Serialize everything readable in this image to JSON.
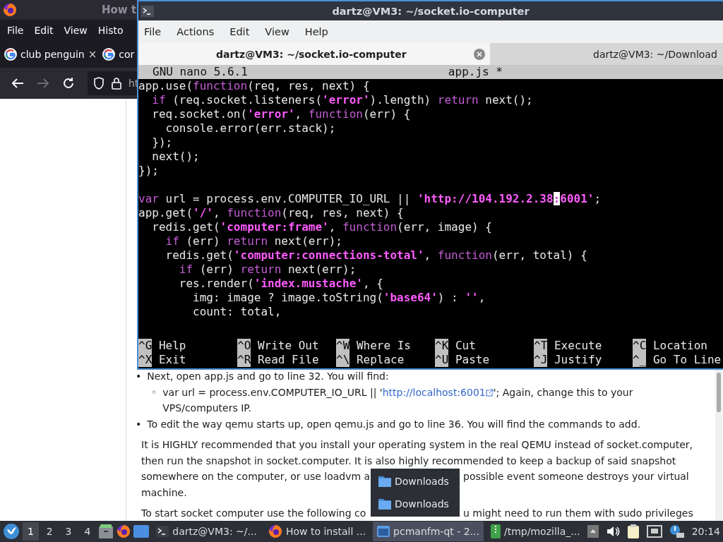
{
  "browser": {
    "title": "How t",
    "menu": [
      "File",
      "Edit",
      "View",
      "Histo"
    ],
    "tabs": [
      {
        "label": "club penguin",
        "close": "×"
      },
      {
        "label": "cor"
      }
    ],
    "nav": [
      {
        "kind": "back",
        "disabled": false
      },
      {
        "kind": "forward",
        "disabled": true
      },
      {
        "kind": "reload",
        "disabled": false
      }
    ],
    "address": "ht",
    "article": {
      "bullets": [
        {
          "marker": "•",
          "text": "Next, open app.js and go to line 32. You will find:",
          "children": [
            {
              "marker": "◦",
              "before": "var url = process.env.COMPUTER_IO_URL || '",
              "link": "http://localhost:6001",
              "after": "'; Again, change this to your VPS/computers IP."
            }
          ]
        },
        {
          "marker": "•",
          "text": "To edit the way qemu starts up, open qemu.js and go to line 36. You will find the commands to add."
        }
      ],
      "paragraphs": [
        {
          "lines": [
            [
              "It is HIGHLY recommended that you install your operating system in the real QEMU instead of socket.computer,"
            ],
            [
              "then run the snapshot in socket.computer. It is also highly recommended to keep a backup of said snapshot"
            ],
            [
              "somewhere on the computer, or use loadvm a",
              "possible event someone destroys your virtual"
            ],
            [
              "machine."
            ]
          ]
        },
        {
          "lines": [
            [
              "To start socket computer use the following co",
              "u might need to run them with sudo privileges"
            ]
          ]
        }
      ]
    }
  },
  "terminal": {
    "title": "dartz@VM3: ~/socket.io-computer",
    "menu": [
      "File",
      "Actions",
      "Edit",
      "View",
      "Help"
    ],
    "tabs": [
      {
        "label": "dartz@VM3: ~/socket.io-computer",
        "selected": true
      },
      {
        "label": "dartz@VM3: ~/Download",
        "selected": false
      }
    ],
    "nano": {
      "version": "GNU nano 5.6.1",
      "file": "app.js *",
      "lines": [
        {
          "segments": [
            {
              "text": "app.use(",
              "kind": "plain"
            },
            {
              "text": "function",
              "kind": "keyword"
            },
            {
              "text": "(req, res, next) {",
              "kind": "plain"
            }
          ]
        },
        {
          "segments": [
            {
              "text": "  if",
              "kind": "keyword"
            },
            {
              "text": " (req.socket.listeners(",
              "kind": "plain"
            },
            {
              "text": "'error'",
              "kind": "string"
            },
            {
              "text": ").length) ",
              "kind": "plain"
            },
            {
              "text": "return",
              "kind": "keyword"
            },
            {
              "text": " next();",
              "kind": "plain"
            }
          ]
        },
        {
          "segments": [
            {
              "text": "  req.socket.on(",
              "kind": "plain"
            },
            {
              "text": "'error'",
              "kind": "string"
            },
            {
              "text": ", ",
              "kind": "plain"
            },
            {
              "text": "function",
              "kind": "keyword"
            },
            {
              "text": "(err) {",
              "kind": "plain"
            }
          ]
        },
        {
          "segments": [
            {
              "text": "    console.error(err.stack);",
              "kind": "plain"
            }
          ]
        },
        {
          "segments": [
            {
              "text": "  });",
              "kind": "plain"
            }
          ]
        },
        {
          "segments": [
            {
              "text": "  next();",
              "kind": "plain"
            }
          ]
        },
        {
          "segments": [
            {
              "text": "});",
              "kind": "plain"
            }
          ]
        },
        {
          "blank_before": true,
          "segments": [
            {
              "text": "var",
              "kind": "keyword"
            },
            {
              "text": " url = process.env.COMPUTER_IO_URL || ",
              "kind": "plain"
            },
            {
              "text": "'http://104.192.2.38",
              "kind": "string"
            },
            {
              "text": ":",
              "kind": "cursor"
            },
            {
              "text": "6001'",
              "kind": "string"
            },
            {
              "text": ";",
              "kind": "plain"
            }
          ]
        },
        {
          "segments": [
            {
              "text": "app.get(",
              "kind": "plain"
            },
            {
              "text": "'/'",
              "kind": "string"
            },
            {
              "text": ", ",
              "kind": "plain"
            },
            {
              "text": "function",
              "kind": "keyword"
            },
            {
              "text": "(req, res, next) {",
              "kind": "plain"
            }
          ]
        },
        {
          "segments": [
            {
              "text": "  redis.get(",
              "kind": "plain"
            },
            {
              "text": "'computer:frame'",
              "kind": "string"
            },
            {
              "text": ", ",
              "kind": "plain"
            },
            {
              "text": "function",
              "kind": "keyword"
            },
            {
              "text": "(err, image) {",
              "kind": "plain"
            }
          ]
        },
        {
          "segments": [
            {
              "text": "    if",
              "kind": "keyword"
            },
            {
              "text": " (err) ",
              "kind": "plain"
            },
            {
              "text": "return",
              "kind": "keyword"
            },
            {
              "text": " next(err);",
              "kind": "plain"
            }
          ]
        },
        {
          "segments": [
            {
              "text": "    redis.get(",
              "kind": "plain"
            },
            {
              "text": "'computer:connections-total'",
              "kind": "string"
            },
            {
              "text": ", ",
              "kind": "plain"
            },
            {
              "text": "function",
              "kind": "keyword"
            },
            {
              "text": "(err, total) {",
              "kind": "plain"
            }
          ]
        },
        {
          "segments": [
            {
              "text": "      if",
              "kind": "keyword"
            },
            {
              "text": " (err) ",
              "kind": "plain"
            },
            {
              "text": "return",
              "kind": "keyword"
            },
            {
              "text": " next(err);",
              "kind": "plain"
            }
          ]
        },
        {
          "segments": [
            {
              "text": "      res.render(",
              "kind": "plain"
            },
            {
              "text": "'index.mustache'",
              "kind": "string"
            },
            {
              "text": ", {",
              "kind": "plain"
            }
          ]
        },
        {
          "segments": [
            {
              "text": "        img: image ? image.toString(",
              "kind": "plain"
            },
            {
              "text": "'base64'",
              "kind": "string"
            },
            {
              "text": ") : ",
              "kind": "plain"
            },
            {
              "text": "''",
              "kind": "string"
            },
            {
              "text": ",",
              "kind": "plain"
            }
          ]
        },
        {
          "segments": [
            {
              "text": "        count: total,",
              "kind": "plain"
            }
          ]
        }
      ],
      "shortcuts": [
        {
          "key": "^G",
          "label": "Help"
        },
        {
          "key": "^O",
          "label": "Write Out"
        },
        {
          "key": "^W",
          "label": "Where Is"
        },
        {
          "key": "^K",
          "label": "Cut"
        },
        {
          "key": "^T",
          "label": "Execute"
        },
        {
          "key": "^C",
          "label": "Location"
        },
        {
          "key": "^X",
          "label": "Exit"
        },
        {
          "key": "^R",
          "label": "Read File"
        },
        {
          "key": "^\\",
          "label": "Replace"
        },
        {
          "key": "^U",
          "label": "Paste"
        },
        {
          "key": "^J",
          "label": "Justify"
        },
        {
          "key": "^_",
          "label": "Go To Line"
        }
      ]
    }
  },
  "popup": {
    "items": [
      {
        "label": "Downloads"
      },
      {
        "label": "Downloads"
      }
    ]
  },
  "taskbar": {
    "workspaces": [
      {
        "label": "1",
        "selected": true
      },
      {
        "label": "2",
        "selected": false
      },
      {
        "label": "3",
        "selected": false
      },
      {
        "label": "4",
        "selected": false
      }
    ],
    "tasks": [
      {
        "kind": "terminal",
        "label": "dartz@VM3: ~/...",
        "selected": false
      },
      {
        "kind": "browser",
        "label": "How to install ...",
        "selected": false
      },
      {
        "kind": "folder",
        "label": "pcmanfm-qt - 2...",
        "selected": true
      },
      {
        "kind": "archive",
        "label": "/tmp/mozilla_...",
        "selected": false
      }
    ],
    "clock": "20:14"
  }
}
